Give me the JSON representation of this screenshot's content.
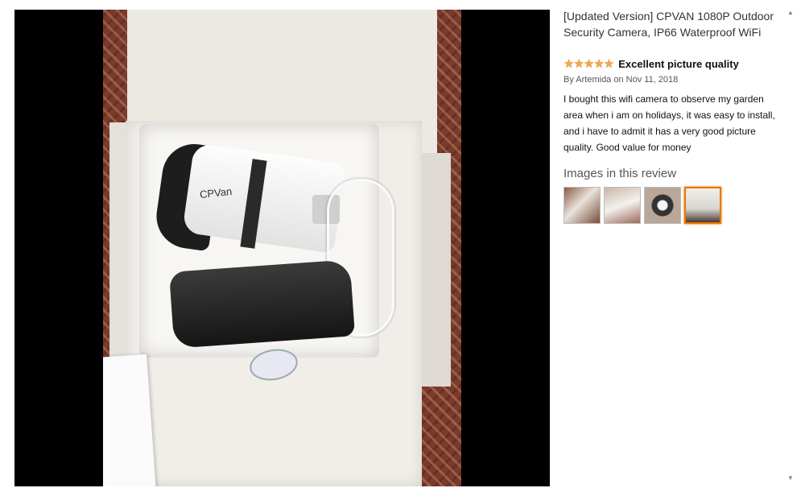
{
  "product": {
    "title": "[Updated Version] CPVAN 1080P Outdoor Security Camera, IP66 Waterproof WiFi"
  },
  "review": {
    "stars": "★★★★★",
    "rating": 5,
    "rating_max": 5,
    "title": "Excellent picture quality",
    "byline": "By Artemida on Nov 11, 2018",
    "body": "I bought this wifi camera to observe my garden area when i am on holidays, it was easy to install, and i have to admit it has a very good picture quality. Good value for money"
  },
  "images_section": {
    "label": "Images in this review",
    "thumbnail_count": 4,
    "selected_index": 3
  },
  "photo": {
    "logo_text": "CPVan"
  },
  "scrollbar": {
    "up_glyph": "▲",
    "down_glyph": "▼"
  },
  "colors": {
    "star": "#f3a847",
    "selected_thumb_border": "#e77600",
    "viewer_background": "#000000"
  }
}
